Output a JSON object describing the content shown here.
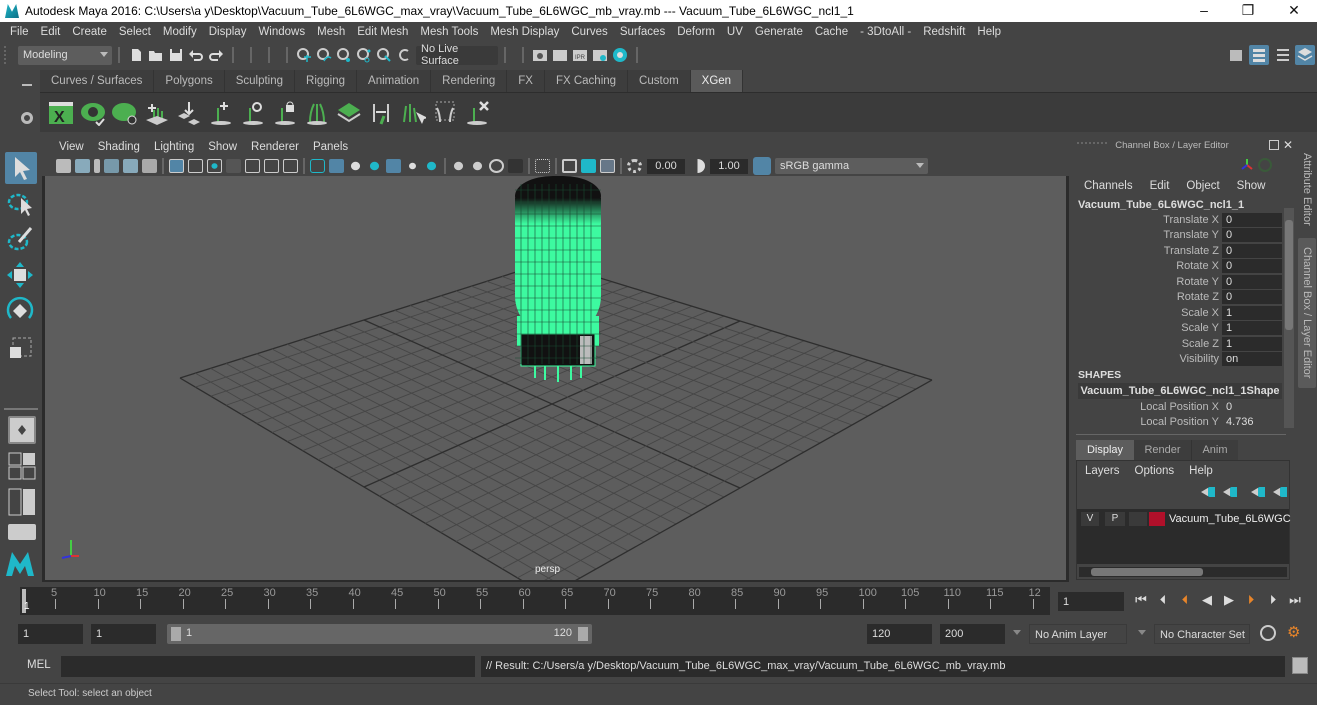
{
  "title_bar": {
    "text": "Autodesk Maya 2016: C:\\Users\\a y\\Desktop\\Vacuum_Tube_6L6WGC_max_vray\\Vacuum_Tube_6L6WGC_mb_vray.mb   ---   Vacuum_Tube_6L6WGC_ncl1_1",
    "minimize": "–",
    "restore": "❐",
    "close": "✕"
  },
  "menu_bar": [
    "File",
    "Edit",
    "Create",
    "Select",
    "Modify",
    "Display",
    "Windows",
    "Mesh",
    "Edit Mesh",
    "Mesh Tools",
    "Mesh Display",
    "Curves",
    "Surfaces",
    "Deform",
    "UV",
    "Generate",
    "Cache",
    "- 3DtoAll -",
    "Redshift",
    "Help"
  ],
  "status_line": {
    "menu_set": "Modeling",
    "live_surface": "No Live Surface"
  },
  "shelf_tabs": {
    "items": [
      "Curves / Surfaces",
      "Polygons",
      "Sculpting",
      "Rigging",
      "Animation",
      "Rendering",
      "FX",
      "FX Caching",
      "Custom",
      "XGen"
    ],
    "active": "XGen"
  },
  "xgen_shelf_icons": [
    "xgen-window-icon",
    "preview-icon",
    "clear-preview-icon",
    "place-guides-icon",
    "add-guide-icon",
    "add-guide-plus-icon",
    "toggle-guide-visibility-icon",
    "lock-guides-icon",
    "guide-lengths-icon",
    "grid-guides-icon",
    "sculpt-guides-icon",
    "select-guides-icon",
    "guide-bounds-icon",
    "delete-guides-icon"
  ],
  "viewport": {
    "menu": [
      "View",
      "Shading",
      "Lighting",
      "Show",
      "Renderer",
      "Panels"
    ],
    "exposure": "0.00",
    "gamma": "1.00",
    "color_space": "sRGB gamma",
    "camera_label": "persp",
    "object_color": "#3dfaa0"
  },
  "channel_box": {
    "title": "Channel Box / Layer Editor",
    "menu": [
      "Channels",
      "Edit",
      "Object",
      "Show"
    ],
    "object_name": "Vacuum_Tube_6L6WGC_ncl1_1",
    "attributes": [
      {
        "label": "Translate X",
        "value": "0"
      },
      {
        "label": "Translate Y",
        "value": "0"
      },
      {
        "label": "Translate Z",
        "value": "0"
      },
      {
        "label": "Rotate X",
        "value": "0"
      },
      {
        "label": "Rotate Y",
        "value": "0"
      },
      {
        "label": "Rotate Z",
        "value": "0"
      },
      {
        "label": "Scale X",
        "value": "1"
      },
      {
        "label": "Scale Y",
        "value": "1"
      },
      {
        "label": "Scale Z",
        "value": "1"
      },
      {
        "label": "Visibility",
        "value": "on"
      }
    ],
    "shapes_header": "SHAPES",
    "shape_name": "Vacuum_Tube_6L6WGC_ncl1_1Shape",
    "shape_attributes": [
      {
        "label": "Local Position X",
        "value": "0"
      },
      {
        "label": "Local Position Y",
        "value": "4.736"
      }
    ]
  },
  "side_tabs": [
    "Attribute Editor",
    "Channel Box / Layer Editor"
  ],
  "layer_editor": {
    "tabs": [
      "Display",
      "Render",
      "Anim"
    ],
    "active_tab": "Display",
    "menu": [
      "Layers",
      "Options",
      "Help"
    ],
    "layers": [
      {
        "v": "V",
        "p": "P",
        "color": "#b0102a",
        "name": "Vacuum_Tube_6L6WGC"
      }
    ]
  },
  "timeline": {
    "ticks": [
      "5",
      "10",
      "15",
      "20",
      "25",
      "30",
      "35",
      "40",
      "45",
      "50",
      "55",
      "60",
      "65",
      "70",
      "75",
      "80",
      "85",
      "90",
      "95",
      "100",
      "105",
      "110",
      "115",
      "12"
    ],
    "current_frame_marker": "1",
    "current_frame": "1"
  },
  "range": {
    "start": "1",
    "playback_start": "1",
    "slider_start": "1",
    "slider_end": "120",
    "playback_end": "120",
    "end": "200",
    "anim_layer": "No Anim Layer",
    "character_set": "No Character Set"
  },
  "command_line": {
    "label": "MEL",
    "input": "",
    "result": "// Result: C:/Users/a y/Desktop/Vacuum_Tube_6L6WGC_max_vray/Vacuum_Tube_6L6WGC_mb_vray.mb"
  },
  "help_line": "Select Tool: select an object"
}
